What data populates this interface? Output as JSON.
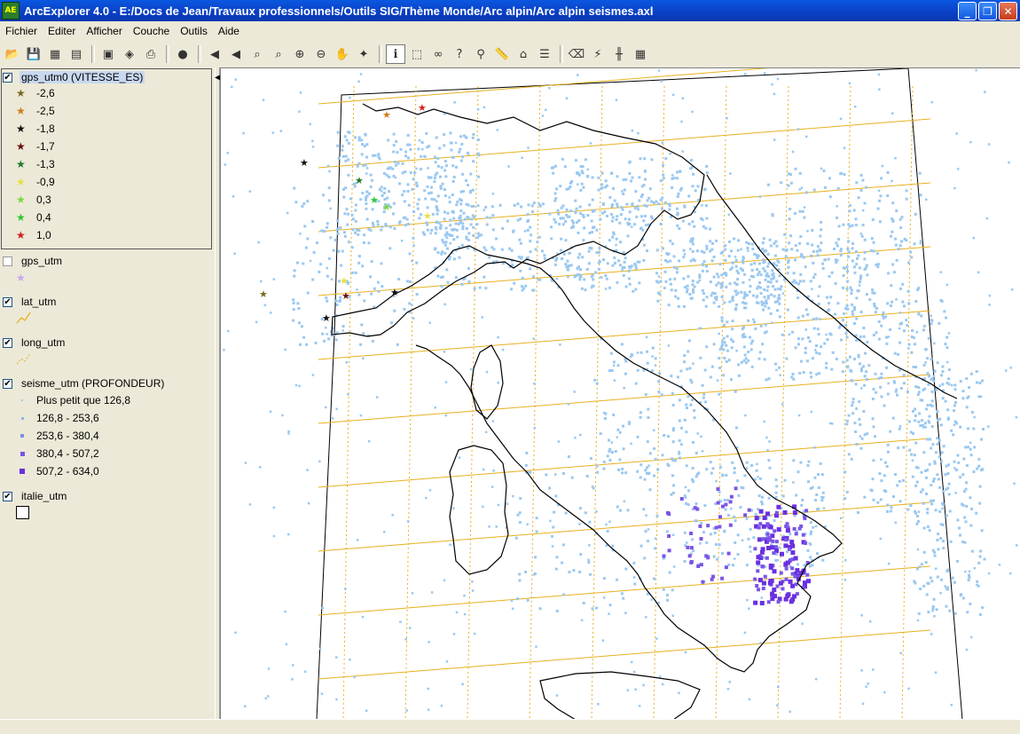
{
  "window": {
    "title": "ArcExplorer 4.0 - E:/Docs de Jean/Travaux professionnels/Outils SIG/Thème Monde/Arc alpin/Arc alpin seismes.axl"
  },
  "menu": [
    "Fichier",
    "Editer",
    "Afficher",
    "Couche",
    "Outils",
    "Aide"
  ],
  "toolbar": [
    "open",
    "save",
    "save-image",
    "export",
    "print-setup",
    "copy",
    "print",
    "globe",
    "zoom-previous",
    "zoom-next",
    "zoom-extent",
    "zoom-layer",
    "zoom-in",
    "zoom-out",
    "pan",
    "full-extent",
    "identify",
    "select",
    "find",
    "query",
    "address",
    "measure",
    "buffer",
    "properties",
    "erase",
    "hyperlink",
    "grid",
    "table"
  ],
  "layers": {
    "gps_utm0": {
      "name": "gps_utm0 (VITESSE_ES)",
      "checked": true,
      "classes": [
        {
          "label": "-2,6",
          "color": "#7a6a1a"
        },
        {
          "label": "-2,5",
          "color": "#d27b1c"
        },
        {
          "label": "-1,8",
          "color": "#111111"
        },
        {
          "label": "-1,7",
          "color": "#6b1010"
        },
        {
          "label": "-1,3",
          "color": "#1f7a2a"
        },
        {
          "label": "-0,9",
          "color": "#e8e040"
        },
        {
          "label": "0,3",
          "color": "#7ad83a"
        },
        {
          "label": "0,4",
          "color": "#2ec82e"
        },
        {
          "label": "1,0",
          "color": "#d02020"
        }
      ]
    },
    "gps_utm": {
      "name": "gps_utm",
      "checked": false,
      "color": "#c8a8f0"
    },
    "lat_utm": {
      "name": "lat_utm",
      "checked": true,
      "color": "#e8b020"
    },
    "long_utm": {
      "name": "long_utm",
      "checked": true,
      "color": "#e8b020"
    },
    "seisme_utm": {
      "name": "seisme_utm (PROFONDEUR)",
      "checked": true,
      "classes": [
        {
          "label": "Plus petit que 126,8",
          "color": "#9ac8f0"
        },
        {
          "label": "126,8 - 253,6",
          "color": "#8cb4f0"
        },
        {
          "label": "253,6 - 380,4",
          "color": "#7c8ee8"
        },
        {
          "label": "380,4 - 507,2",
          "color": "#7a55e6"
        },
        {
          "label": "507,2 - 634,0",
          "color": "#6a30e0"
        }
      ]
    },
    "italie_utm": {
      "name": "italie_utm",
      "checked": true
    }
  }
}
